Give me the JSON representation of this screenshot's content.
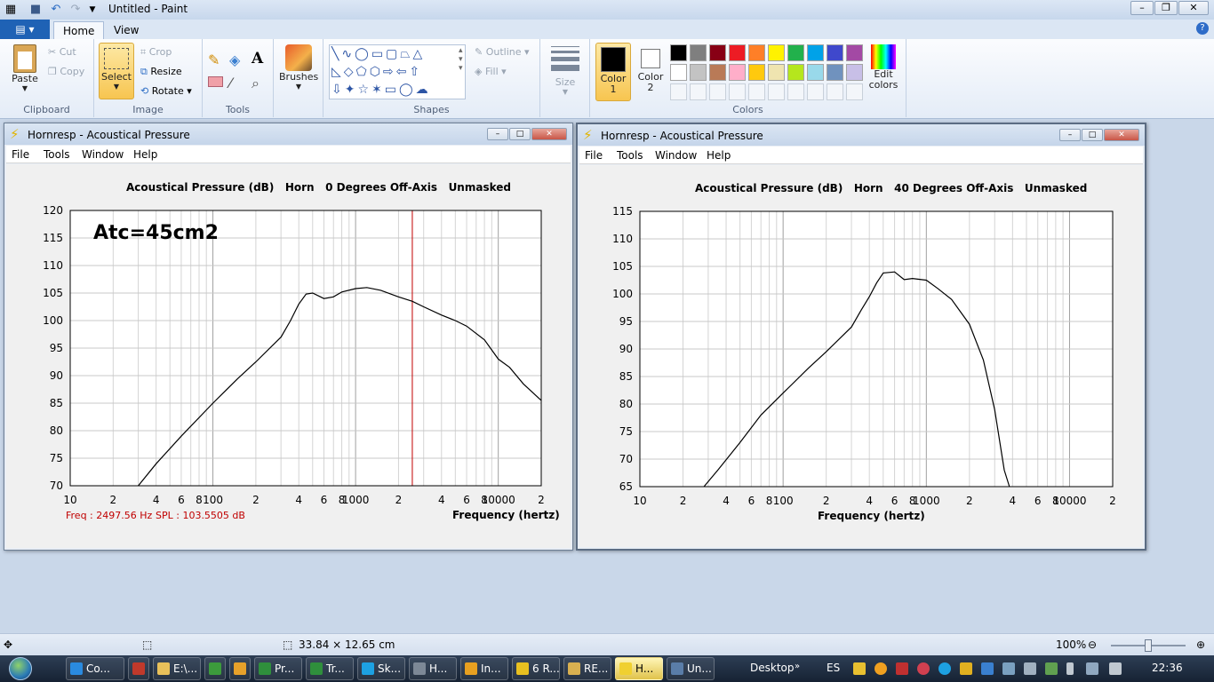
{
  "app": {
    "title": "Untitled - Paint"
  },
  "ribbon": {
    "file_tab": "",
    "tabs": [
      "Home",
      "View"
    ],
    "clipboard": {
      "paste": "Paste",
      "cut": "Cut",
      "copy": "Copy",
      "label": "Clipboard"
    },
    "image": {
      "select": "Select",
      "crop": "Crop",
      "resize": "Resize",
      "rotate": "Rotate",
      "label": "Image"
    },
    "tools": {
      "label": "Tools"
    },
    "brushes": {
      "label": "Brushes"
    },
    "shapes": {
      "label": "Shapes",
      "outline": "Outline",
      "fill": "Fill"
    },
    "size": {
      "label": "Size"
    },
    "colors": {
      "color1": "Color 1",
      "color2": "Color 2",
      "edit": "Edit colors",
      "label": "Colors",
      "palette_row1": [
        "#000000",
        "#7f7f7f",
        "#880015",
        "#ed1c24",
        "#ff7f27",
        "#fff200",
        "#22b14c",
        "#00a2e8",
        "#3f48cc",
        "#a349a4"
      ],
      "palette_row2": [
        "#ffffff",
        "#c3c3c3",
        "#b97a57",
        "#ffaec9",
        "#ffc90e",
        "#efe4b0",
        "#b5e61d",
        "#99d9ea",
        "#7092be",
        "#c8bfe7"
      ]
    }
  },
  "window_left": {
    "title": "Hornresp - Acoustical Pressure",
    "menu": [
      "File",
      "Tools",
      "Window",
      "Help"
    ],
    "plot_title": "Acoustical Pressure (dB)   Horn   0 Degrees Off-Axis   Unmasked",
    "annotation": "Atc=45cm2",
    "xlabel": "Frequency (hertz)",
    "readout_freq": "Freq : 2497.56 Hz",
    "readout_spl": "SPL : 103.5505 dB"
  },
  "window_right": {
    "title": "Hornresp - Acoustical Pressure",
    "menu": [
      "File",
      "Tools",
      "Window",
      "Help"
    ],
    "plot_title": "Acoustical Pressure (dB)   Horn   40 Degrees Off-Axis   Unmasked",
    "xlabel": "Frequency (hertz)"
  },
  "chart_data": [
    {
      "type": "line",
      "title": "Acoustical Pressure (dB)   Horn   0 Degrees Off-Axis   Unmasked",
      "xlabel": "Frequency (hertz)",
      "ylabel": "",
      "xscale": "log",
      "xlim": [
        10,
        20000
      ],
      "ylim": [
        70,
        120
      ],
      "x_tick_labels": [
        "10",
        "2",
        "4",
        "6",
        "8",
        "100",
        "2",
        "4",
        "6",
        "8",
        "1000",
        "2",
        "4",
        "6",
        "8",
        "10000",
        "2"
      ],
      "y_ticks": [
        70,
        75,
        80,
        85,
        90,
        95,
        100,
        105,
        110,
        115,
        120
      ],
      "marker_frequency": 2497.56,
      "series": [
        {
          "x": [
            30,
            40,
            60,
            100,
            150,
            200,
            300,
            350,
            400,
            450,
            500,
            600,
            700,
            800,
            1000,
            1200,
            1500,
            2000,
            2500,
            3000,
            4000,
            5000,
            6000,
            8000,
            10000,
            12000,
            15000,
            20000
          ],
          "y": [
            70,
            74,
            79,
            85,
            89.5,
            92.5,
            97,
            100,
            103,
            104.8,
            105,
            104,
            104.3,
            105.2,
            105.8,
            106,
            105.5,
            104.3,
            103.5,
            102.5,
            101,
            100,
            99,
            96.5,
            93,
            91.5,
            88.5,
            85.5
          ]
        }
      ]
    },
    {
      "type": "line",
      "title": "Acoustical Pressure (dB)   Horn   40 Degrees Off-Axis   Unmasked",
      "xlabel": "Frequency (hertz)",
      "ylabel": "",
      "xscale": "log",
      "xlim": [
        10,
        20000
      ],
      "ylim": [
        65,
        115
      ],
      "x_tick_labels": [
        "10",
        "2",
        "4",
        "6",
        "8",
        "100",
        "2",
        "4",
        "6",
        "8",
        "1000",
        "2",
        "4",
        "6",
        "8",
        "10000",
        "2"
      ],
      "y_ticks": [
        65,
        70,
        75,
        80,
        85,
        90,
        95,
        100,
        105,
        110,
        115
      ],
      "series": [
        {
          "x": [
            28,
            35,
            50,
            70,
            100,
            150,
            200,
            300,
            350,
            400,
            450,
            500,
            600,
            700,
            800,
            1000,
            1200,
            1500,
            2000,
            2500,
            3000,
            3500,
            3800
          ],
          "y": [
            65,
            68,
            73,
            78,
            82,
            86.5,
            89.5,
            94,
            97,
            99.5,
            102,
            103.8,
            104,
            102.6,
            102.8,
            102.5,
            101,
            99,
            94.5,
            88,
            79,
            68,
            65
          ]
        }
      ]
    }
  ],
  "statusbar": {
    "dimensions": "33.84 × 12.65 cm",
    "zoom": "100%"
  },
  "taskbar": {
    "items": [
      {
        "label": "Co...",
        "color": "#2a8adf"
      },
      {
        "label": "",
        "color": "#c0392b"
      },
      {
        "label": "E:\\...",
        "color": "#e8c05a"
      },
      {
        "label": "",
        "color": "#3c9b3c"
      },
      {
        "label": "",
        "color": "#e7a12a"
      },
      {
        "label": "Pr...",
        "color": "#2f8f3c"
      },
      {
        "label": "Tr...",
        "color": "#2f8f3c"
      },
      {
        "label": "Sk...",
        "color": "#1da1e2"
      },
      {
        "label": "H...",
        "color": "#7d8896"
      },
      {
        "label": "In...",
        "color": "#e8a020"
      },
      {
        "label": "6 R...",
        "color": "#e8c020"
      },
      {
        "label": "RE...",
        "color": "#d8b050"
      },
      {
        "label": "H...",
        "color": "#f0d030"
      },
      {
        "label": "Un...",
        "color": "#5a7da8"
      }
    ],
    "desktop": "Desktop",
    "lang": "ES",
    "clock": "22:36"
  }
}
